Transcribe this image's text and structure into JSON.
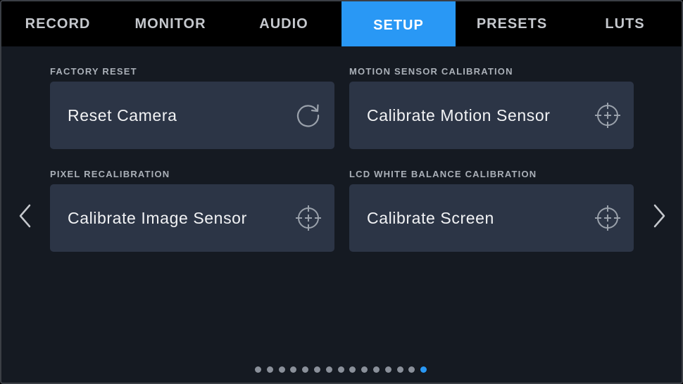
{
  "tabs": [
    {
      "label": "RECORD",
      "active": false
    },
    {
      "label": "MONITOR",
      "active": false
    },
    {
      "label": "AUDIO",
      "active": false
    },
    {
      "label": "SETUP",
      "active": true
    },
    {
      "label": "PRESETS",
      "active": false
    },
    {
      "label": "LUTS",
      "active": false
    }
  ],
  "sections": {
    "factory_reset": {
      "label": "FACTORY RESET",
      "button": "Reset Camera",
      "icon": "reset-icon"
    },
    "motion_sensor": {
      "label": "MOTION SENSOR CALIBRATION",
      "button": "Calibrate Motion Sensor",
      "icon": "crosshair-icon"
    },
    "pixel_recalibration": {
      "label": "PIXEL RECALIBRATION",
      "button": "Calibrate Image Sensor",
      "icon": "crosshair-icon"
    },
    "lcd_white_balance": {
      "label": "LCD WHITE BALANCE CALIBRATION",
      "button": "Calibrate Screen",
      "icon": "crosshair-icon"
    }
  },
  "navigation": {
    "prev_icon": "chevron-left-icon",
    "next_icon": "chevron-right-icon"
  },
  "pagination": {
    "total_pages": 15,
    "current_page": 15
  },
  "colors": {
    "accent": "#2998f5",
    "background": "#151a22",
    "card": "#2c3546",
    "tab_bar": "#000000"
  }
}
